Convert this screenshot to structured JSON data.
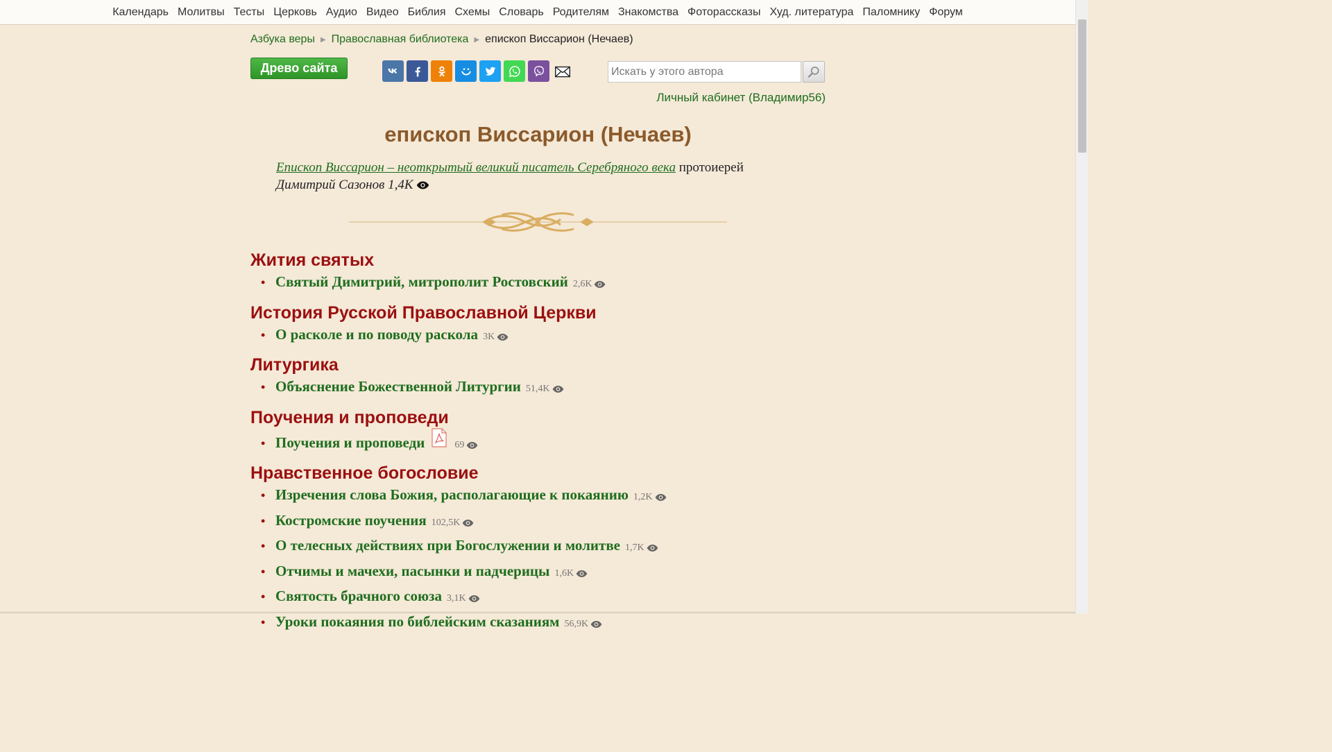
{
  "nav": [
    "Календарь",
    "Молитвы",
    "Тесты",
    "Церковь",
    "Аудио",
    "Видео",
    "Библия",
    "Схемы",
    "Словарь",
    "Родителям",
    "Знакомства",
    "Фоторассказы",
    "Худ. литература",
    "Паломнику",
    "Форум"
  ],
  "breadcrumb": {
    "items": [
      "Азбука веры",
      "Православная библиотека"
    ],
    "current": "епископ Виссарион (Нечаев)"
  },
  "tree_button": "Древо сайта",
  "share": [
    "vk",
    "facebook",
    "odnoklassniki",
    "moimir",
    "twitter",
    "whatsapp",
    "viber",
    "email"
  ],
  "search": {
    "placeholder": "Искать у этого автора"
  },
  "cabinet_link": "Личный кабинет (Владимир56)",
  "title": "епископ Виссарион (Нечаев)",
  "featured": {
    "title": "Епископ Виссарион – неоткрытый великий писатель Серебряного века",
    "author_role": "протоиерей",
    "author": "Димитрий Сазонов",
    "views": "1,4K"
  },
  "colors": {
    "background": "#f5e9d8",
    "link": "#1e6e1e",
    "section": "#9b1010",
    "title": "#8b5a2b"
  },
  "sections": [
    {
      "title": "Жития святых",
      "items": [
        {
          "title": "Святый Димитрий, митрополит Ростовский",
          "views": "2,6K"
        }
      ]
    },
    {
      "title": "История Русской Православной Церкви",
      "items": [
        {
          "title": "О расколе и по поводу раскола",
          "views": "3K"
        }
      ]
    },
    {
      "title": "Литургика",
      "items": [
        {
          "title": "Объяснение Божественной Литургии",
          "views": "51,4K"
        }
      ]
    },
    {
      "title": "Поучения и проповеди",
      "items": [
        {
          "title": "Поучения и проповеди",
          "views": "69",
          "pdf": true
        }
      ]
    },
    {
      "title": "Нравственное богословие",
      "items": [
        {
          "title": "Изречения слова Божия, располагающие к покаянию",
          "views": "1,2K"
        },
        {
          "title": "Костромские поучения",
          "views": "102,5K"
        },
        {
          "title": "О телесных действиях при Богослужении и молитве",
          "views": "1,7K"
        },
        {
          "title": "Отчимы и мачехи, пасынки и падчерицы",
          "views": "1,6K"
        },
        {
          "title": "Святость брачного союза",
          "views": "3,1K"
        },
        {
          "title": "Уроки покаяния по библейским сказаниям",
          "views": "56,9K"
        }
      ]
    }
  ]
}
